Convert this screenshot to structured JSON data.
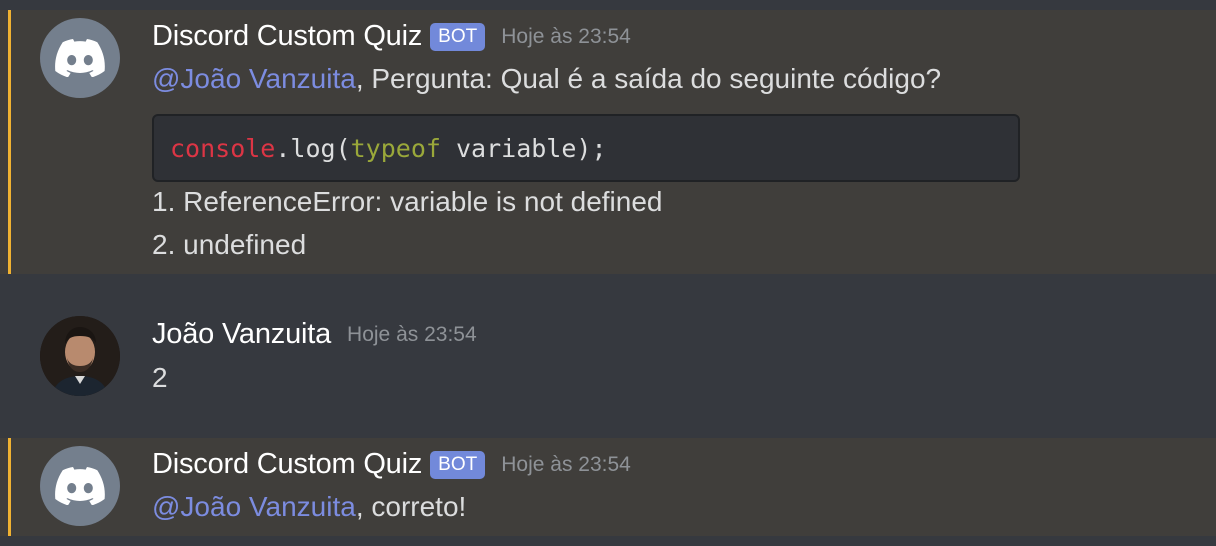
{
  "colors": {
    "background": "#36393f",
    "highlight_background": "#403e3b",
    "highlight_bar": "#f0b232",
    "mention": "#7c8ce0",
    "bot_tag": "#7289da",
    "code_keyword_object": "#dc3545",
    "code_keyword_typeof": "#9aa83a"
  },
  "messages": [
    {
      "author": "Discord Custom Quiz",
      "bot_tag": "BOT",
      "timestamp": "Hoje às 23:54",
      "avatar_icon": "discord-logo-icon",
      "mention": "@João Vanzuita",
      "text": ", Pergunta: Qual é a saída do seguinte código?",
      "code": {
        "object": "console",
        "dot_log": ".log(",
        "keyword": "typeof",
        "rest": " variable);"
      },
      "options": [
        "1. ReferenceError: variable is not defined",
        "2. undefined"
      ]
    },
    {
      "author": "João Vanzuita",
      "timestamp": "Hoje às 23:54",
      "avatar_icon": "user-photo-avatar",
      "text": "2"
    },
    {
      "author": "Discord Custom Quiz",
      "bot_tag": "BOT",
      "timestamp": "Hoje às 23:54",
      "avatar_icon": "discord-logo-icon",
      "mention": "@João Vanzuita",
      "text": ", correto!"
    }
  ]
}
